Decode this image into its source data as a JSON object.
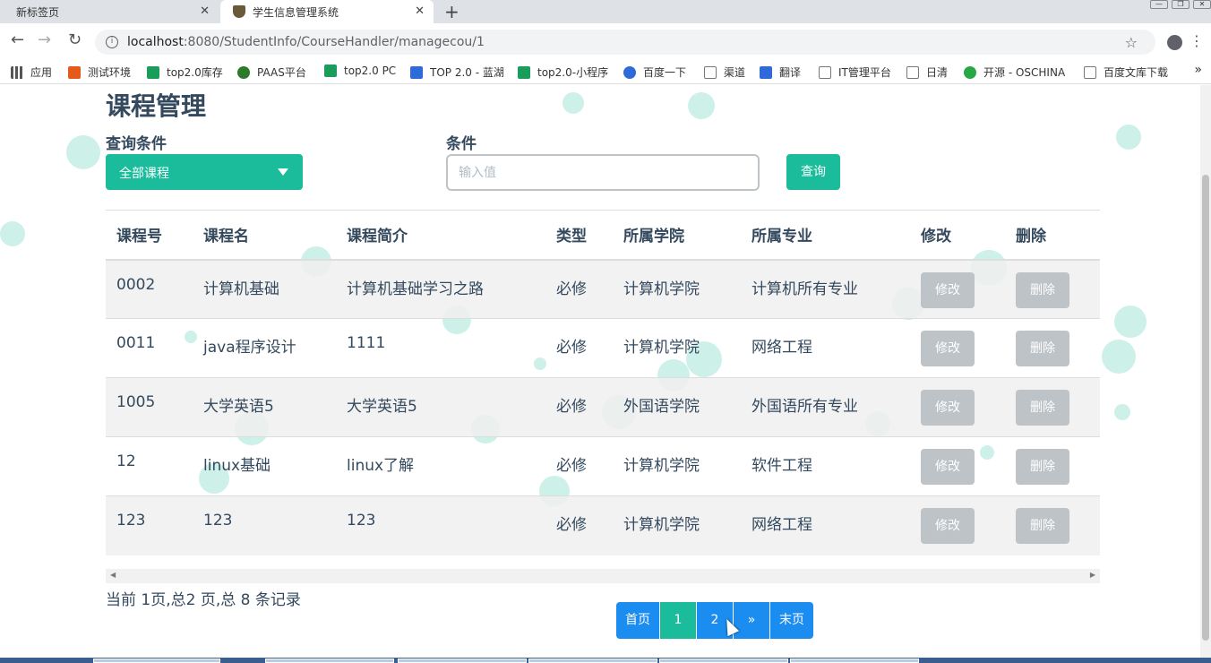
{
  "browser": {
    "tabs": [
      {
        "title": "新标签页"
      },
      {
        "title": "学生信息管理系统"
      }
    ],
    "address": {
      "host": "localhost",
      "path": ":8080/StudentInfo/CourseHandler/managecou/1"
    },
    "bookmarks": [
      {
        "label": "应用",
        "color": "#555"
      },
      {
        "label": "测试环境",
        "color": "#e35a1a"
      },
      {
        "label": "top2.0库存",
        "color": "#1a9c5a"
      },
      {
        "label": "PAAS平台",
        "color": "#2d7a2d"
      },
      {
        "label": "top2.0 PC",
        "color": "#1a9c5a"
      },
      {
        "label": "TOP 2.0 - 蓝湖",
        "color": "#2f6bd8"
      },
      {
        "label": "top2.0-小程序",
        "color": "#1a9c5a"
      },
      {
        "label": "百度一下",
        "color": "#2f6bd8"
      },
      {
        "label": "渠道",
        "color": "#999"
      },
      {
        "label": "翻译",
        "color": "#2f6bd8"
      },
      {
        "label": "IT管理平台",
        "color": "#999"
      },
      {
        "label": "日清",
        "color": "#999"
      },
      {
        "label": "开源 - OSCHINA",
        "color": "#28a745"
      },
      {
        "label": "百度文库下载",
        "color": "#999"
      }
    ]
  },
  "page": {
    "title": "课程管理",
    "filter_label": "查询条件",
    "filter_value": "全部课程",
    "condition_label": "条件",
    "condition_placeholder": "输入值",
    "query_button": "查询"
  },
  "table": {
    "headers": [
      "课程号",
      "课程名",
      "课程简介",
      "类型",
      "所属学院",
      "所属专业",
      "修改",
      "删除"
    ],
    "rows": [
      {
        "id": "0002",
        "name": "计算机基础",
        "intro": "计算机基础学习之路",
        "type": "必修",
        "college": "计算机学院",
        "major": "计算机所有专业",
        "edit": "修改",
        "delete": "删除"
      },
      {
        "id": "0011",
        "name": "java程序设计",
        "intro": "1111",
        "type": "必修",
        "college": "计算机学院",
        "major": "网络工程",
        "edit": "修改",
        "delete": "删除"
      },
      {
        "id": "1005",
        "name": "大学英语5",
        "intro": "大学英语5",
        "type": "必修",
        "college": "外国语学院",
        "major": "外国语所有专业",
        "edit": "修改",
        "delete": "删除"
      },
      {
        "id": "12",
        "name": "linux基础",
        "intro": "linux了解",
        "type": "必修",
        "college": "计算机学院",
        "major": "软件工程",
        "edit": "修改",
        "delete": "删除"
      },
      {
        "id": "123",
        "name": "123",
        "intro": "123",
        "type": "必修",
        "college": "计算机学院",
        "major": "网络工程",
        "edit": "修改",
        "delete": "删除"
      }
    ]
  },
  "footer": {
    "summary": "当前 1页,总2 页,总 8 条记录",
    "pager": {
      "first": "首页",
      "p1": "1",
      "p2": "2",
      "next": "»",
      "last": "末页"
    }
  },
  "colors": {
    "accent": "#1abc9c",
    "pager": "#1b8cf0",
    "disabled": "#bdc3c7",
    "text": "#34495e"
  }
}
